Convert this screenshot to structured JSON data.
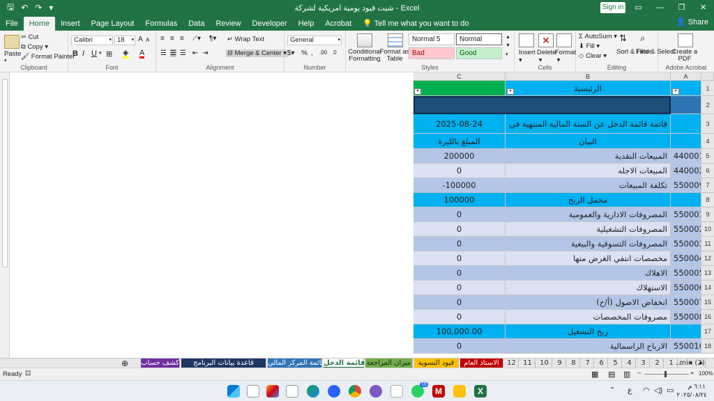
{
  "titlebar": {
    "title": "شيت قيود يومية امريكية لشركة  -  Excel",
    "sign_in": "Sign in"
  },
  "tabs": [
    "File",
    "Home",
    "Insert",
    "Page Layout",
    "Formulas",
    "Data",
    "Review",
    "Developer",
    "Help",
    "Acrobat"
  ],
  "tell_me": "Tell me what you want to do",
  "share": "Share",
  "ribbon": {
    "clipboard": {
      "label": "Clipboard",
      "paste": "Paste",
      "cut": "Cut",
      "copy": "Copy",
      "format_painter": "Format Painter"
    },
    "font": {
      "label": "Font",
      "name": "Calibri",
      "size": "18"
    },
    "alignment": {
      "label": "Alignment",
      "wrap": "Wrap Text",
      "merge": "Merge & Center"
    },
    "number": {
      "label": "Number",
      "format": "General"
    },
    "styles": {
      "label": "Styles",
      "conditional": "Conditional Formatting",
      "format_as_table": "Format as Table",
      "normal5": "Normal 5",
      "normal": "Normal",
      "bad": "Bad",
      "good": "Good"
    },
    "cells": {
      "label": "Cells",
      "insert": "Insert",
      "delete": "Delete",
      "format": "Format"
    },
    "editing": {
      "label": "Editing",
      "autosum": "AutoSum",
      "fill": "Fill",
      "clear": "Clear",
      "sort": "Sort & Filter",
      "find": "Find & Select"
    },
    "acrobat": {
      "label": "Adobe Acrobat",
      "create": "Create a PDF"
    }
  },
  "sheet": {
    "columns": [
      "C",
      "B",
      "A"
    ],
    "header_main": "الرئيسية",
    "title_row": "قائمة قائمة الدخل عن السنة المالية المنتهية في",
    "title_date": "2025-08-24",
    "col_desc": "البيان",
    "col_amount": "المبلغ بالليرة",
    "rows": [
      {
        "num": "5",
        "code": "440001",
        "desc": "المبيعات النقدية",
        "amount": "200000",
        "style": "a"
      },
      {
        "num": "6",
        "code": "440002",
        "desc": "المبيعات الاجله",
        "amount": "0",
        "style": "b"
      },
      {
        "num": "7",
        "code": "550009",
        "desc": "تكلفة المبيعات",
        "amount": "-100000",
        "style": "a"
      },
      {
        "num": "8",
        "code": "",
        "desc": "مجمل الربح",
        "amount": "100000",
        "style": "h"
      },
      {
        "num": "9",
        "code": "550001",
        "desc": "المصروفات الادارية والعمومية",
        "amount": "0",
        "style": "a"
      },
      {
        "num": "10",
        "code": "550002",
        "desc": "المصروفات التشغيلية",
        "amount": "0",
        "style": "b"
      },
      {
        "num": "11",
        "code": "550003",
        "desc": "المصروفات التسوقية والبيعية",
        "amount": "0",
        "style": "a"
      },
      {
        "num": "12",
        "code": "550004",
        "desc": "مخصصات انتفي الغرض منها",
        "amount": "0",
        "style": "b"
      },
      {
        "num": "13",
        "code": "550005",
        "desc": "الاهلاك",
        "amount": "0",
        "style": "a"
      },
      {
        "num": "14",
        "code": "550006",
        "desc": "الاستهلاك",
        "amount": "0",
        "style": "b"
      },
      {
        "num": "15",
        "code": "550007",
        "desc": "(أ/خ) انخفاض الاصول",
        "amount": "0",
        "style": "a"
      },
      {
        "num": "16",
        "code": "550008",
        "desc": "مصروفات المخصصات",
        "amount": "0",
        "style": "b"
      },
      {
        "num": "17",
        "code": "",
        "desc": "ربح التشغيل",
        "amount": "100,000.00",
        "style": "h"
      },
      {
        "num": "18",
        "code": "550010",
        "desc": "الارباح الراسمالية",
        "amount": "0",
        "style": "a"
      }
    ]
  },
  "sheet_tabs": [
    {
      "label": "كشف حساب",
      "color": "#7030a0",
      "text": "#ffffff"
    },
    {
      "label": "قاعدة بيانات البرنامج",
      "color": "#1f3864",
      "text": "#ffffff"
    },
    {
      "label": "قائمة المركز المالي",
      "color": "#2e75b6",
      "text": "#ffffff"
    },
    {
      "label": "قائمة الدخل",
      "color": "#ffffff",
      "text": "#217346"
    },
    {
      "label": "ميزان المراجعة",
      "color": "#70ad47",
      "text": "#222222"
    },
    {
      "label": "قيود التسوية",
      "color": "#ffc000",
      "text": "#222222"
    },
    {
      "label": "الاستاذ العام",
      "color": "#c00000",
      "text": "#ffffff"
    },
    {
      "label": "12",
      "color": "#e6e6e6",
      "text": "#333333"
    },
    {
      "label": "11",
      "color": "#e6e6e6",
      "text": "#333333"
    },
    {
      "label": "10",
      "color": "#e6e6e6",
      "text": "#333333"
    },
    {
      "label": "9",
      "color": "#e6e6e6",
      "text": "#333333"
    },
    {
      "label": "8",
      "color": "#e6e6e6",
      "text": "#333333"
    },
    {
      "label": "7",
      "color": "#e6e6e6",
      "text": "#333333"
    },
    {
      "label": "6",
      "color": "#e6e6e6",
      "text": "#333333"
    },
    {
      "label": "5",
      "color": "#e6e6e6",
      "text": "#333333"
    },
    {
      "label": "4",
      "color": "#e6e6e6",
      "text": "#333333"
    },
    {
      "label": "3",
      "color": "#e6e6e6",
      "text": "#333333"
    },
    {
      "label": "2",
      "color": "#e6e6e6",
      "text": "#333333"
    },
    {
      "label": "1",
      "color": "#e6e6e6",
      "text": "#333333"
    },
    {
      "label": "min (2)",
      "color": "#e6e6e6",
      "text": "#333333"
    }
  ],
  "status": {
    "ready": "Ready",
    "zoom": "100%"
  },
  "taskbar": {
    "time": "٦:١١ م",
    "date": "٢٠٢٥/٠٨/٢٤",
    "lang": "ع",
    "badge": "16"
  },
  "colors": {
    "excel_green": "#217346",
    "header_blue": "#00b0f0",
    "row_light": "#b4c6e7",
    "row_lighter": "#d9e1f2",
    "dark_blue": "#1f4e79",
    "green_cell": "#00b050"
  }
}
